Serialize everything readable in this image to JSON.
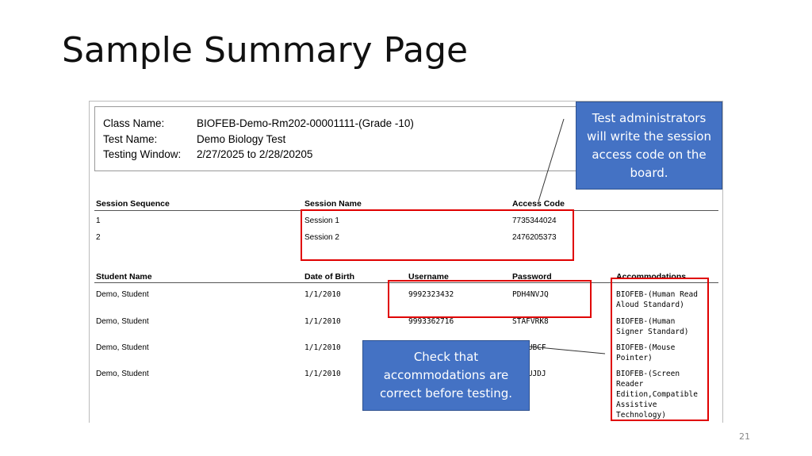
{
  "slide": {
    "title": "Sample Summary Page",
    "page_number": "21"
  },
  "header": {
    "class_label": "Class Name:",
    "class_value": "BIOFEB-Demo-Rm202-00001111-(Grade -10)",
    "test_label": "Test Name:",
    "test_value": "Demo Biology Test",
    "window_label": "Testing Window:",
    "window_value": "2/27/2025 to 2/28/20205"
  },
  "sessions": {
    "headers": [
      "Session Sequence",
      "Session Name",
      "Access Code"
    ],
    "rows": [
      [
        "1",
        "Session 1",
        "7735344024"
      ],
      [
        "2",
        "Session 2",
        "2476205373"
      ]
    ]
  },
  "students": {
    "headers": [
      "Student Name",
      "Date of Birth",
      "Username",
      "Password",
      "Accommodations"
    ],
    "rows": [
      {
        "name": "Demo, Student",
        "dob": "1/1/2010",
        "username": "9992323432",
        "password": "PDH4NVJQ",
        "acc1": "BIOFEB-(Human Read",
        "acc2": "Aloud Standard)"
      },
      {
        "name": "Demo, Student",
        "dob": "1/1/2010",
        "username": "9993362716",
        "password": "STAFVRK8",
        "acc1": "BIOFEB-(Human",
        "acc2": "Signer Standard)"
      },
      {
        "name": "Demo, Student",
        "dob": "1/1/2010",
        "password": "PUBCF",
        "acc1": "BIOFEB-(Mouse",
        "acc2": "Pointer)"
      },
      {
        "name": "Demo, Student",
        "dob": "1/1/2010",
        "password": "SUJDJ",
        "acc1": "BIOFEB-(Screen",
        "acc2": "Reader",
        "acc3": "Edition,Compatible",
        "acc4": "Assistive",
        "acc5": "Technology)"
      }
    ]
  },
  "callouts": {
    "access_code": "Test administrators will write the session access code on the board.",
    "accommodations": "Check that accommodations are correct before testing."
  },
  "colors": {
    "highlight": "#e00000",
    "callout_fill": "#4472c4"
  }
}
